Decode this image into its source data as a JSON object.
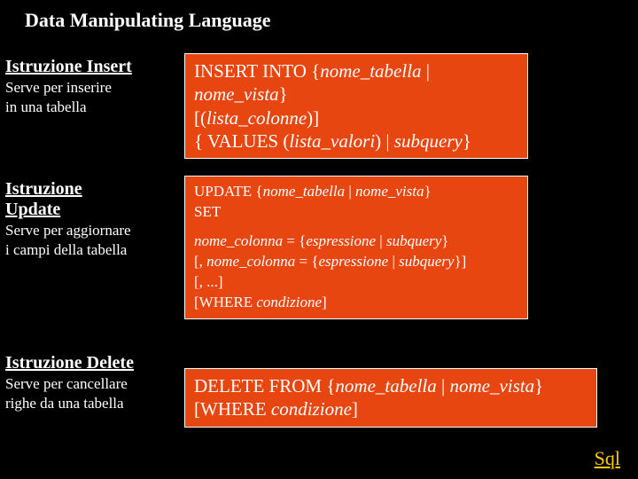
{
  "title": "Data Manipulating Language",
  "insert": {
    "label": "Istruzione Insert",
    "desc1": "Serve per inserire",
    "desc2": "in una tabella",
    "box_l1a": "INSERT INTO {",
    "box_l1b": "nome_tabella",
    "box_l1c": " | ",
    "box_l2a": "nome_vista",
    "box_l2b": "}",
    "box_l3a": "[(",
    "box_l3b": "lista_colonne",
    "box_l3c": ")]",
    "box_l4a": "{ VALUES (",
    "box_l4b": "lista_valori",
    "box_l4c": ") | ",
    "box_l4d": "subquery",
    "box_l4e": "}"
  },
  "update": {
    "label1": "Istruzione",
    "label2": "Update",
    "desc1": "Serve per aggiornare",
    "desc2": "i campi della tabella",
    "box_l1a": "UPDATE {",
    "box_l1b": "nome_tabella",
    "box_l1c": " | ",
    "box_l1d": "nome_vista",
    "box_l1e": "}",
    "box_l2": "SET",
    "box_l3a": "nome_colonna",
    "box_l3b": " = {",
    "box_l3c": "espressione",
    "box_l3d": " | ",
    "box_l3e": "subquery",
    "box_l3f": "}",
    "box_l4a": "[, ",
    "box_l4b": "nome_colonna",
    "box_l4c": " = {",
    "box_l4d": "espressione",
    "box_l4e": " | ",
    "box_l4f": "subquery",
    "box_l4g": "}]",
    "box_l5": "[, ...]",
    "box_l6a": "[WHERE ",
    "box_l6b": "condizione",
    "box_l6c": "]"
  },
  "delete": {
    "label": "Istruzione Delete",
    "desc1": "Serve per cancellare",
    "desc2": "righe da una tabella",
    "box_l1a": "DELETE FROM {",
    "box_l1b": "nome_tabella",
    "box_l1c": " | ",
    "box_l1d": "nome_vista",
    "box_l1e": "}",
    "box_l2a": "[WHERE ",
    "box_l2b": "condizione",
    "box_l2c": "]"
  },
  "footer": "Sql"
}
